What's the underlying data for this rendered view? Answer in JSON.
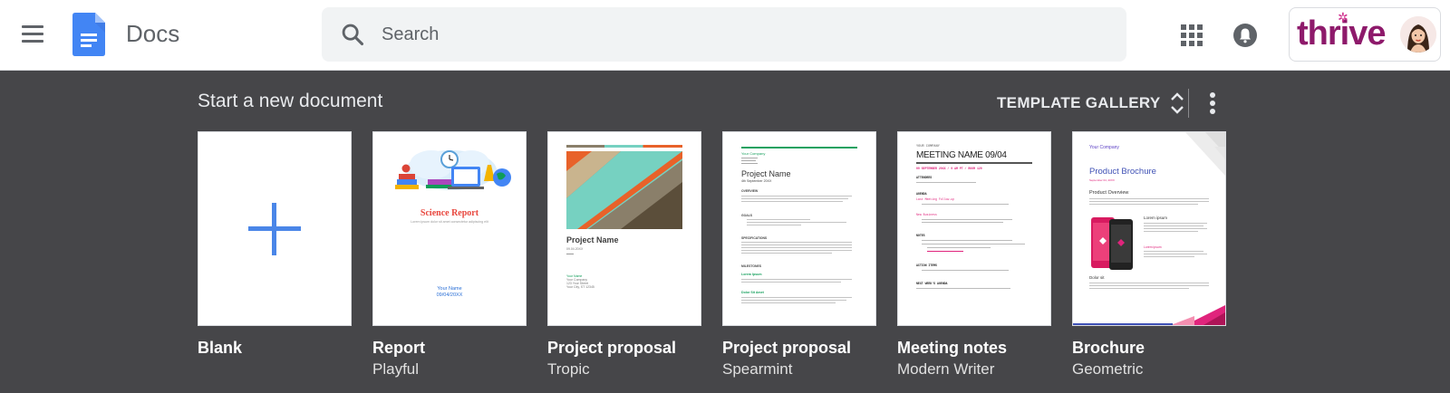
{
  "header": {
    "app_title": "Docs",
    "search_placeholder": "Search",
    "brand_name": "thrive",
    "icons": [
      "menu-icon",
      "docs-logo-icon",
      "search-icon",
      "apps-grid-icon",
      "notifications-icon",
      "avatar"
    ]
  },
  "templates": {
    "section_title": "Start a new document",
    "gallery_label": "TEMPLATE GALLERY",
    "items": [
      {
        "name": "Blank",
        "subtitle": ""
      },
      {
        "name": "Report",
        "subtitle": "Playful",
        "thumb": {
          "title": "Science Report",
          "line": "Lorem ipsum dolor sit amet consectetur adipiscing elit",
          "author": "Your Name",
          "date": "09/04/20XX"
        }
      },
      {
        "name": "Project proposal",
        "subtitle": "Tropic",
        "thumb": {
          "title": "Project Name",
          "date": "09.04.20XX",
          "company_lines": [
            "Your Name",
            "Your Company",
            "123 Your Street",
            "Your City, ST 12345"
          ]
        }
      },
      {
        "name": "Project proposal",
        "subtitle": "Spearmint",
        "thumb": {
          "company": "Your Company",
          "title": "Project Name",
          "date": "4th September 20XX",
          "headings": [
            "OVERVIEW",
            "GOALS",
            "SPECIFICATIONS",
            "MILESTONES"
          ],
          "milestones": [
            "Lorem Ipsum",
            "Dolor Sit Amet"
          ]
        }
      },
      {
        "name": "Meeting notes",
        "subtitle": "Modern Writer",
        "thumb": {
          "company": "YOUR COMPANY",
          "title": "MEETING NAME 09/04",
          "date_line": "09 SEPTEMBER 20XX / 9 AM PT / ROOM 120",
          "headings": [
            "ATTENDEES",
            "AGENDA",
            "NOTES",
            "ACTION ITEMS",
            "NEXT WEEK'S AGENDA"
          ],
          "agenda_items": [
            "Last Meeting Follow-up",
            "New Business"
          ]
        }
      },
      {
        "name": "Brochure",
        "subtitle": "Geometric",
        "thumb": {
          "company": "Your Company",
          "title": "Product Brochure",
          "date": "September 04, 20XX",
          "overview": "Product Overview",
          "sub_a": "Lorem ipsum",
          "sub_b": "Lorem ipsum",
          "sub_c": "Dolor sit"
        }
      }
    ]
  },
  "colors": {
    "header_bg": "#ffffff",
    "panel_bg": "#464649",
    "docs_blue": "#4285f4",
    "brand_purple": "#8e1a6b"
  }
}
